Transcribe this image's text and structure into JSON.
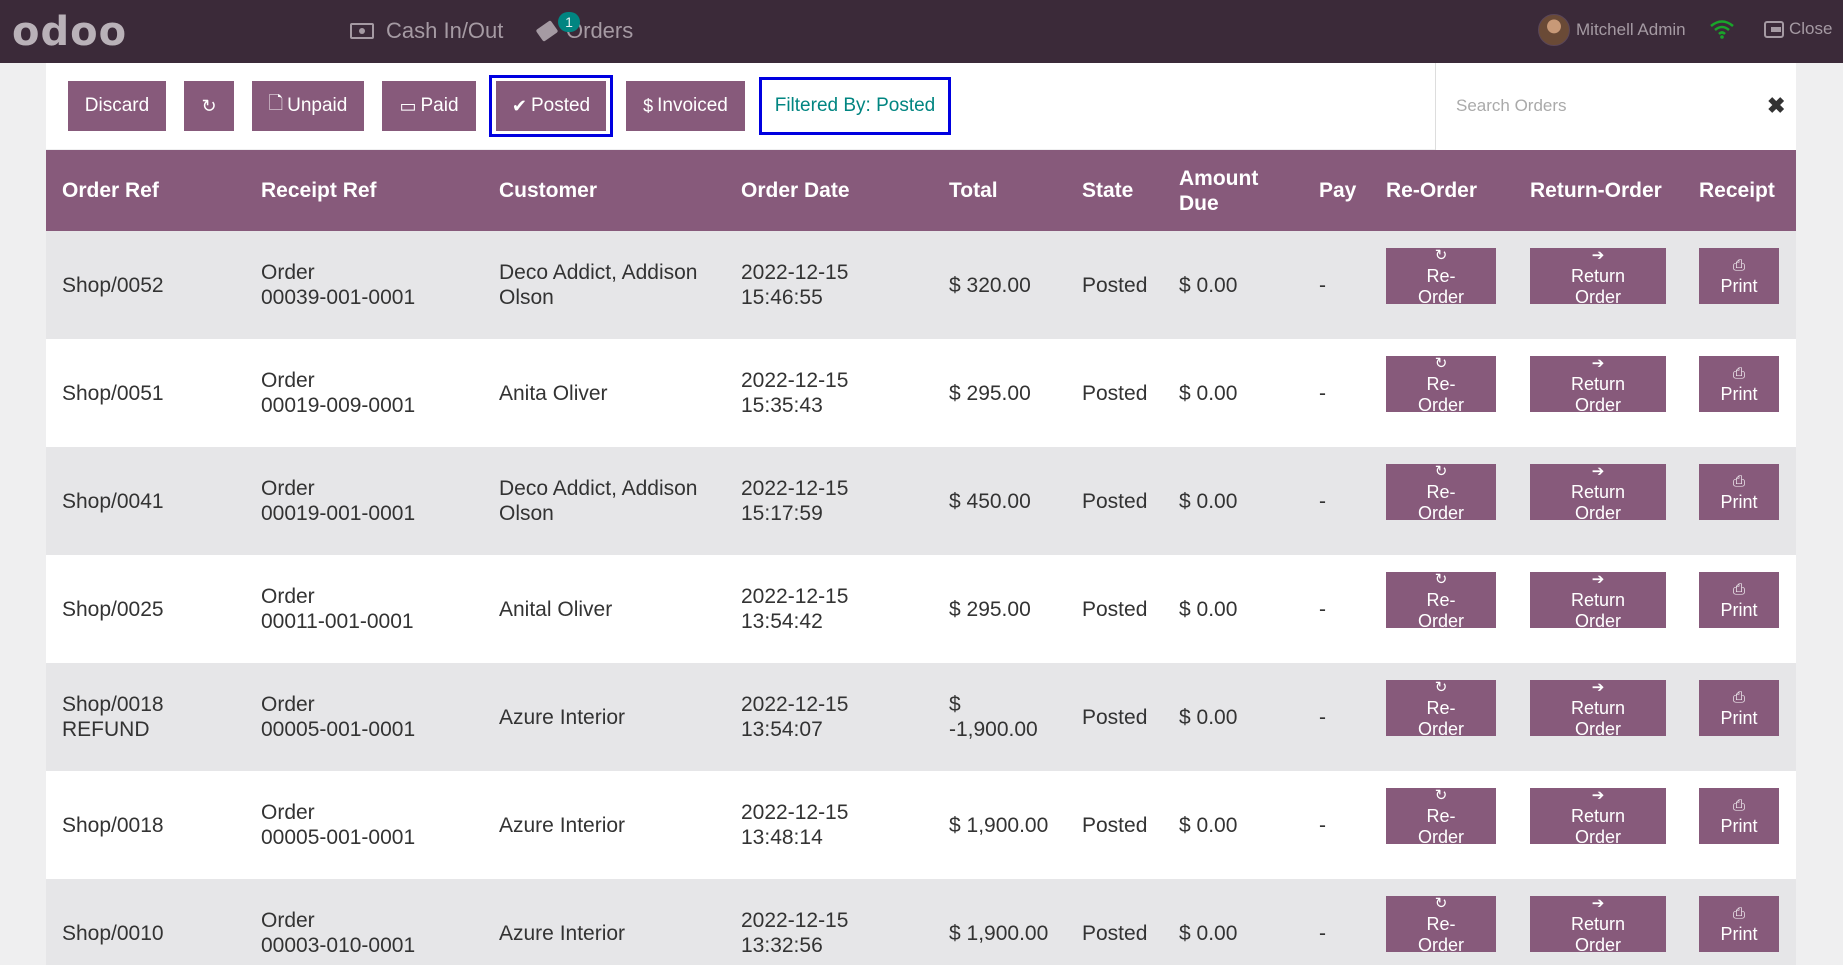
{
  "topbar": {
    "logo": "odoo",
    "cash_label": "Cash In/Out",
    "orders_label": "Orders",
    "orders_badge": "1",
    "user_name": "Mitchell Admin",
    "close_label": "Close"
  },
  "controls": {
    "discard": "Discard",
    "unpaid": "Unpaid",
    "paid": "Paid",
    "posted": "Posted",
    "invoiced": "Invoiced",
    "filter_label": "Filtered By: Posted",
    "search_placeholder": "Search Orders"
  },
  "table": {
    "headers": {
      "order_ref": "Order Ref",
      "receipt_ref": "Receipt Ref",
      "customer": "Customer",
      "order_date": "Order Date",
      "total": "Total",
      "state": "State",
      "amount_due": "Amount\nDue",
      "pay": "Pay",
      "reorder": "Re-Order",
      "return_order": "Return-Order",
      "receipt": "Receipt"
    },
    "buttons": {
      "reorder": "Re-\nOrder",
      "return": "Return\nOrder",
      "print": "Print"
    },
    "rows": [
      {
        "order_ref": "Shop/0052",
        "receipt_ref": "Order\n00039-001-0001",
        "customer": "Deco Addict, Addison\nOlson",
        "order_date": "2022-12-15\n15:46:55",
        "total": "$ 320.00",
        "state": "Posted",
        "amount_due": "$ 0.00",
        "pay": "-"
      },
      {
        "order_ref": "Shop/0051",
        "receipt_ref": "Order\n00019-009-0001",
        "customer": "Anita Oliver",
        "order_date": "2022-12-15\n15:35:43",
        "total": "$ 295.00",
        "state": "Posted",
        "amount_due": "$ 0.00",
        "pay": "-"
      },
      {
        "order_ref": "Shop/0041",
        "receipt_ref": "Order\n00019-001-0001",
        "customer": "Deco Addict, Addison\nOlson",
        "order_date": "2022-12-15\n15:17:59",
        "total": "$ 450.00",
        "state": "Posted",
        "amount_due": "$ 0.00",
        "pay": "-"
      },
      {
        "order_ref": "Shop/0025",
        "receipt_ref": "Order\n00011-001-0001",
        "customer": "Anital Oliver",
        "order_date": "2022-12-15\n13:54:42",
        "total": "$ 295.00",
        "state": "Posted",
        "amount_due": "$ 0.00",
        "pay": "-"
      },
      {
        "order_ref": "Shop/0018\nREFUND",
        "receipt_ref": "Order\n00005-001-0001",
        "customer": "Azure Interior",
        "order_date": "2022-12-15\n13:54:07",
        "total": "$\n-1,900.00",
        "state": "Posted",
        "amount_due": "$ 0.00",
        "pay": "-"
      },
      {
        "order_ref": "Shop/0018",
        "receipt_ref": "Order\n00005-001-0001",
        "customer": "Azure Interior",
        "order_date": "2022-12-15\n13:48:14",
        "total": "$ 1,900.00",
        "state": "Posted",
        "amount_due": "$ 0.00",
        "pay": "-"
      },
      {
        "order_ref": "Shop/0010",
        "receipt_ref": "Order\n00003-010-0001",
        "customer": "Azure Interior",
        "order_date": "2022-12-15\n13:32:56",
        "total": "$ 1,900.00",
        "state": "Posted",
        "amount_due": "$ 0.00",
        "pay": "-"
      }
    ]
  },
  "colors": {
    "topbar": "#3b2a39",
    "primary": "#875a7b",
    "teal": "#018581",
    "highlight_border": "#0000e0"
  }
}
